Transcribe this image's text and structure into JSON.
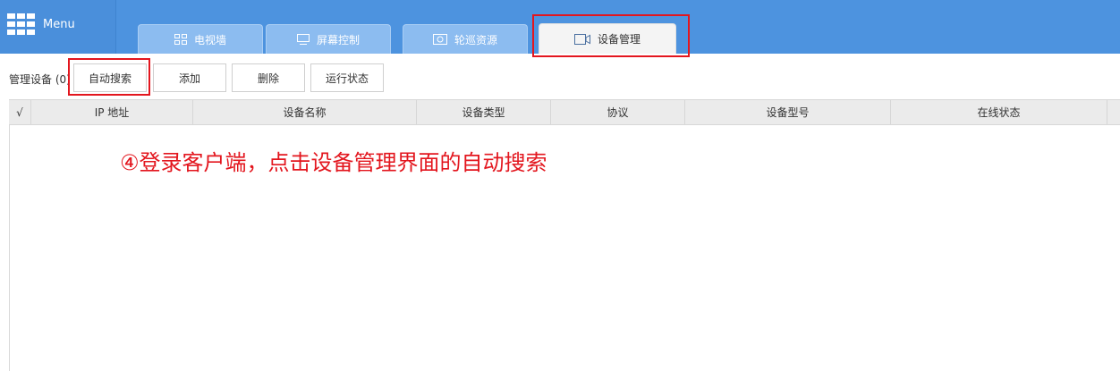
{
  "app": {
    "menu_label": "Menu"
  },
  "tabs": [
    {
      "label": "电视墙",
      "icon": "grid-icon",
      "active": false
    },
    {
      "label": "屏幕控制",
      "icon": "monitor-icon",
      "active": false
    },
    {
      "label": "轮巡资源",
      "icon": "camera-icon",
      "active": false
    },
    {
      "label": "设备管理",
      "icon": "video-camera-icon",
      "active": true
    }
  ],
  "toolbar": {
    "label": "管理设备 (0)",
    "buttons": [
      "自动搜索",
      "添加",
      "删除",
      "运行状态"
    ]
  },
  "table": {
    "columns": [
      "√",
      "IP 地址",
      "设备名称",
      "设备类型",
      "协议",
      "设备型号",
      "在线状态"
    ]
  },
  "annotation": "④登录客户端，点击设备管理界面的自动搜索",
  "colors": {
    "topbar": "#4d93df",
    "highlight": "#e3161e"
  }
}
